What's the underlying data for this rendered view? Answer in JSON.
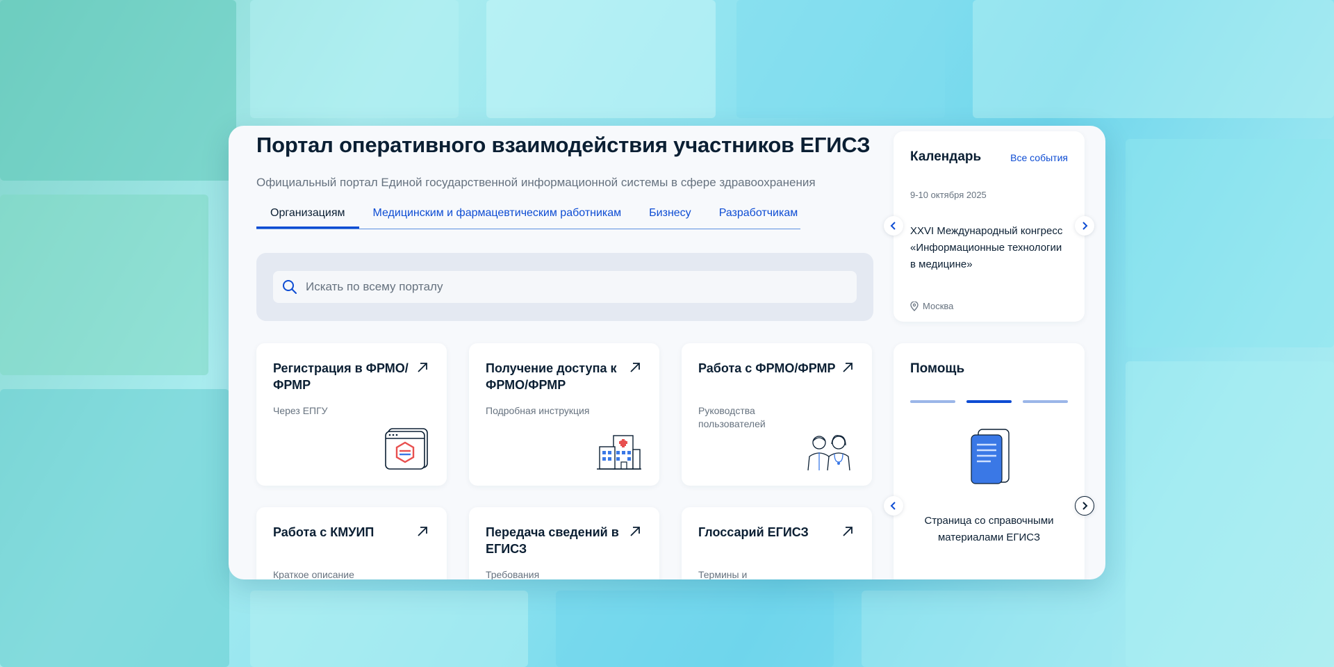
{
  "colors": {
    "accent": "#0d4cd3",
    "text": "#0b1f33",
    "muted": "#66727f"
  },
  "header": {
    "title": "Портал оперативного взаимодействия участников ЕГИСЗ",
    "subtitle": "Официальный портал Единой государственной информационной системы в сфере здравоохранения"
  },
  "tabs": [
    {
      "label": "Организациям",
      "active": true
    },
    {
      "label": "Медицинским и фармацевтическим работникам",
      "active": false
    },
    {
      "label": "Бизнесу",
      "active": false
    },
    {
      "label": "Разработчикам",
      "active": false
    }
  ],
  "search": {
    "placeholder": "Искать по всему порталу",
    "icon": "search-icon"
  },
  "tiles": [
    {
      "title": "Регистрация в ФРМО/ФРМР",
      "subtitle": "Через ЕПГУ",
      "icon": "arrow-up-right-icon",
      "illustration": "browser-window-icon"
    },
    {
      "title": "Получение доступа к ФРМО/ФРМР",
      "subtitle": "Подробная инструкция",
      "icon": "arrow-up-right-icon",
      "illustration": "hospital-icon"
    },
    {
      "title": "Работа с ФРМО/ФРМР",
      "subtitle": "Руководства пользователей",
      "icon": "arrow-up-right-icon",
      "illustration": "doctors-icon"
    },
    {
      "title": "Работа с КМУИП",
      "subtitle": "Краткое описание",
      "icon": "arrow-up-right-icon"
    },
    {
      "title": "Передача сведений в ЕГИСЗ",
      "subtitle": "Требования",
      "icon": "arrow-up-right-icon"
    },
    {
      "title": "Глоссарий ЕГИСЗ",
      "subtitle": "Термины и сокращения",
      "icon": "arrow-up-right-icon"
    }
  ],
  "calendar": {
    "title": "Календарь",
    "all_events": "Все события",
    "date": "9-10 октября 2025",
    "event": "XXVI Международный конгресс «Информационные технологии в медицине»",
    "location": "Москва"
  },
  "help": {
    "title": "Помощь",
    "text": "Страница со справочными материалами ЕГИСЗ",
    "slides_total": 3,
    "slide_active": 2
  }
}
